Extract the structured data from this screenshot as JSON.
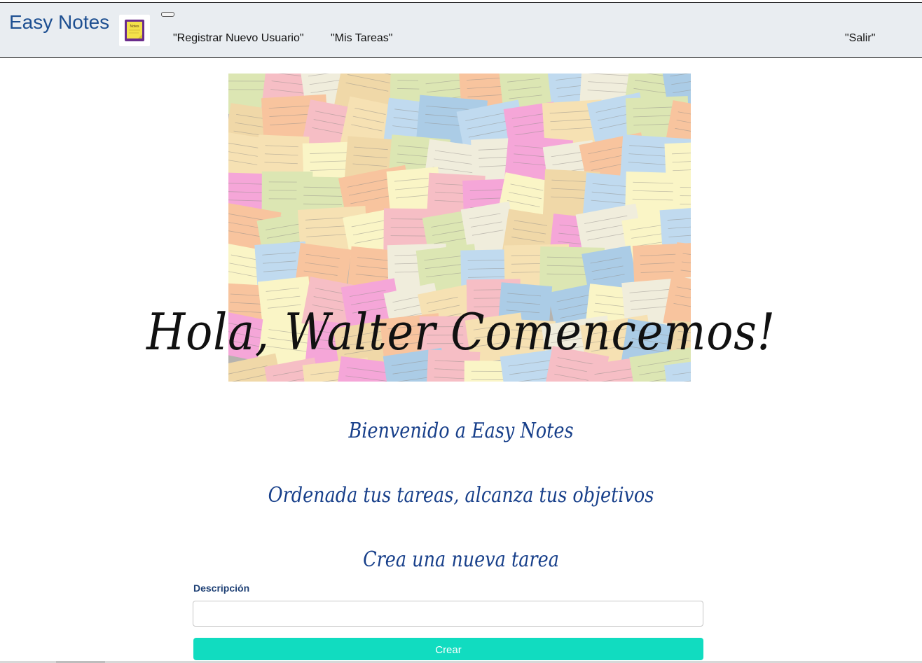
{
  "navbar": {
    "brand": "Easy Notes",
    "logo_text": "Notes",
    "links": [
      "\"Registrar Nuevo Usuario\"",
      "\"Mis Tareas\""
    ],
    "logout": "\"Salir\""
  },
  "hero": {
    "image": "sticky-notes-wall",
    "greeting": "Hola, Walter  Comencemos!"
  },
  "main": {
    "welcome": "Bienvenido a Easy Notes",
    "tagline": "Ordenada tus tareas, alcanza tus objetivos",
    "form_title": "Crea una nueva tarea",
    "description_label": "Descripción",
    "description_value": "",
    "submit_label": "Crear"
  },
  "colors": {
    "brand": "#1d4f91",
    "navbar_bg": "#e9edf1",
    "heading": "#173f8a",
    "button": "#11dcc0"
  }
}
